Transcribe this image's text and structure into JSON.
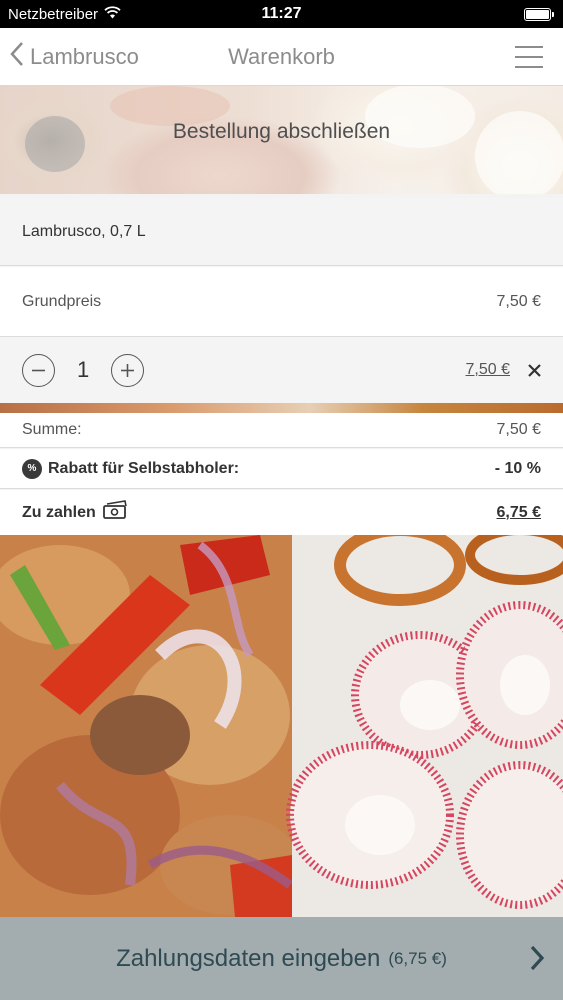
{
  "status_bar": {
    "carrier": "Netzbetreiber",
    "time": "11:27"
  },
  "nav": {
    "back_label": "Lambrusco",
    "title": "Warenkorb"
  },
  "page": {
    "heading": "Bestellung abschließen"
  },
  "cart_item": {
    "name": "Lambrusco, 0,7 L",
    "base_price_label": "Grundpreis",
    "base_price_value": "7,50 €",
    "quantity": "1",
    "line_total": "7,50 €"
  },
  "summary": {
    "sum_label": "Summe:",
    "sum_value": "7,50 €",
    "discount_label": "Rabatt für Selbstabholer:",
    "discount_value": "- 10 %",
    "discount_badge": "%",
    "pay_label": "Zu zahlen",
    "pay_value": "6,75 €"
  },
  "action": {
    "label": "Zahlungsdaten eingeben",
    "amount": "(6,75 €)"
  },
  "icons": {
    "wifi": "wifi-icon",
    "battery": "battery-icon",
    "back": "chevron-left-icon",
    "menu": "hamburger-menu-icon",
    "minus": "minus-circle-icon",
    "plus": "plus-circle-icon",
    "remove": "close-icon",
    "discount": "percent-badge-icon",
    "money": "cash-icon",
    "forward": "chevron-right-icon"
  },
  "colors": {
    "action_bar": "#a3adaf",
    "action_text": "#2f4a52",
    "nav_text": "#8c8c8c"
  }
}
